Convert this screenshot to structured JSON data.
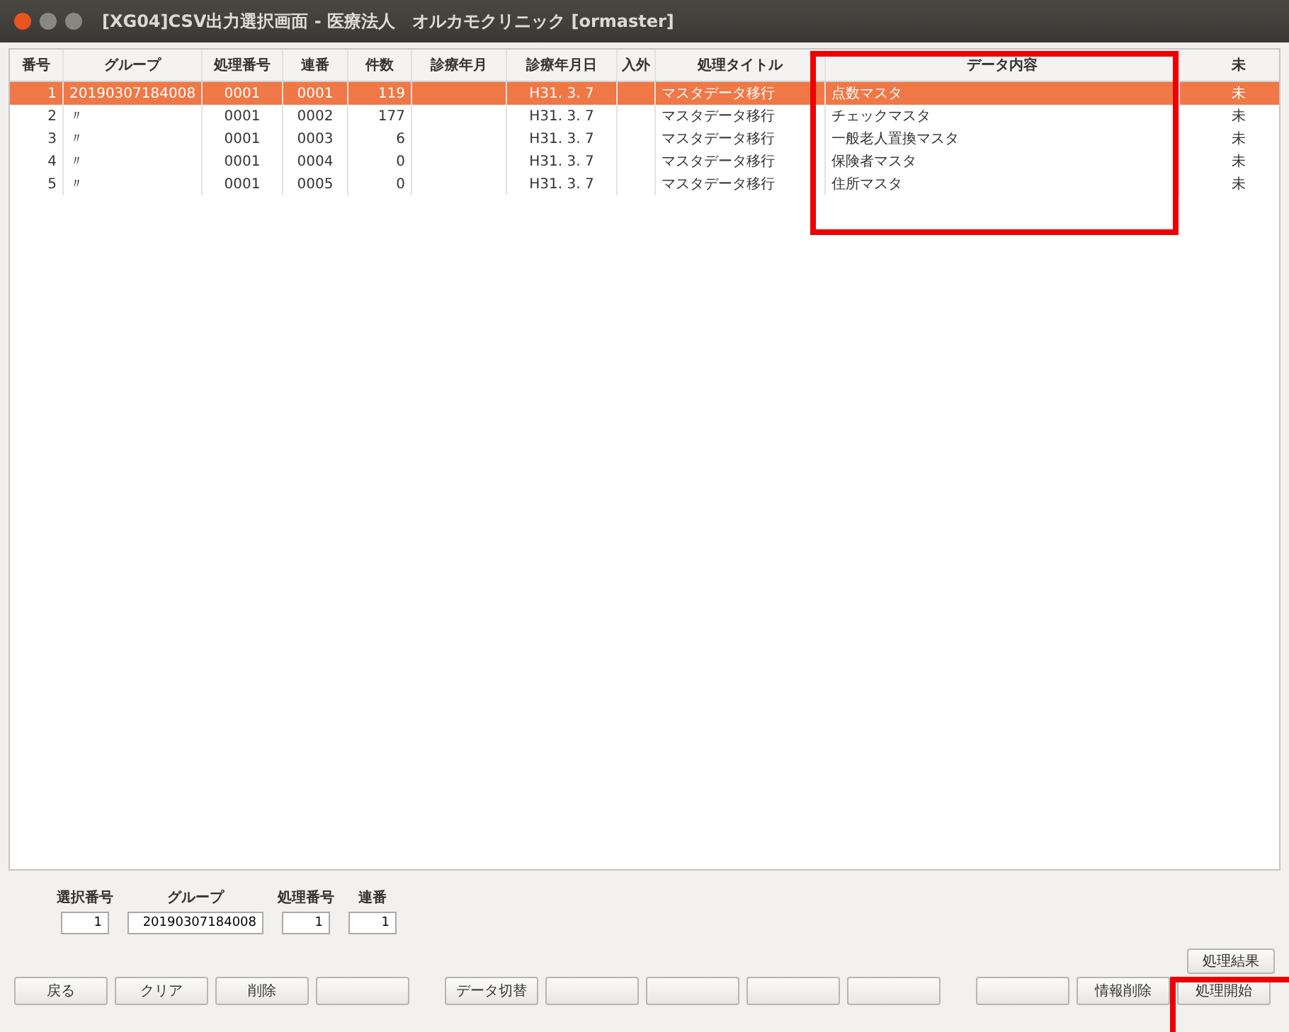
{
  "window": {
    "title": "[XG04]CSV出力選択画面 - 医療法人　オルカモクリニック [ormaster]"
  },
  "table": {
    "columns": [
      "番号",
      "グループ",
      "処理番号",
      "連番",
      "件数",
      "診療年月",
      "診療年月日",
      "入外",
      "処理タイトル",
      "データ内容",
      "未"
    ],
    "rows": [
      {
        "selected": true,
        "cells": [
          "1",
          "20190307184008",
          "0001",
          "0001",
          "119",
          "",
          "H31. 3. 7",
          "",
          "マスタデータ移行",
          "点数マスタ",
          "未"
        ]
      },
      {
        "selected": false,
        "cells": [
          "2",
          "〃",
          "0001",
          "0002",
          "177",
          "",
          "H31. 3. 7",
          "",
          "マスタデータ移行",
          "チェックマスタ",
          "未"
        ]
      },
      {
        "selected": false,
        "cells": [
          "3",
          "〃",
          "0001",
          "0003",
          "6",
          "",
          "H31. 3. 7",
          "",
          "マスタデータ移行",
          "一般老人置換マスタ",
          "未"
        ]
      },
      {
        "selected": false,
        "cells": [
          "4",
          "〃",
          "0001",
          "0004",
          "0",
          "",
          "H31. 3. 7",
          "",
          "マスタデータ移行",
          "保険者マスタ",
          "未"
        ]
      },
      {
        "selected": false,
        "cells": [
          "5",
          "〃",
          "0001",
          "0005",
          "0",
          "",
          "H31. 3. 7",
          "",
          "マスタデータ移行",
          "住所マスタ",
          "未"
        ]
      }
    ]
  },
  "form": {
    "fields": [
      {
        "label": "選択番号",
        "value": "1"
      },
      {
        "label": "グループ",
        "value": "20190307184008"
      },
      {
        "label": "処理番号",
        "value": "1"
      },
      {
        "label": "連番",
        "value": "1"
      }
    ]
  },
  "extra_button": "処理結果",
  "buttons": [
    {
      "kind": "text",
      "label": "戻る"
    },
    {
      "kind": "text",
      "label": "クリア"
    },
    {
      "kind": "text",
      "label": "削除"
    },
    {
      "kind": "blank"
    },
    {
      "kind": "text",
      "label": "データ切替"
    },
    {
      "kind": "blank"
    },
    {
      "kind": "blank"
    },
    {
      "kind": "blank"
    },
    {
      "kind": "blank"
    },
    {
      "kind": "blank"
    },
    {
      "kind": "text",
      "label": "情報削除"
    },
    {
      "kind": "text",
      "label": "処理開始"
    }
  ]
}
